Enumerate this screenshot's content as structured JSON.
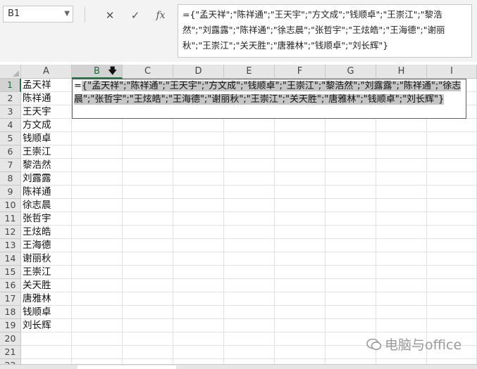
{
  "namebox": {
    "value": "B1"
  },
  "formula_bar": {
    "cancel_glyph": "✕",
    "enter_glyph": "✓",
    "fx_label": "fx",
    "formula": "={\"孟天祥\";\"陈祥通\";\"王天宇\";\"方文成\";\"钱顺卓\";\"王崇江\";\"黎浩然\";\"刘露露\";\"陈祥通\";\"徐志晨\";\"张哲宇\";\"王炫皓\";\"王海德\";\"谢丽秋\";\"王崇江\";\"关天胜\";\"唐雅林\";\"钱顺卓\";\"刘长辉\"}"
  },
  "columns": [
    "A",
    "B",
    "C",
    "D",
    "E",
    "F",
    "G",
    "H",
    "I"
  ],
  "rows": [
    "1",
    "2",
    "3",
    "4",
    "5",
    "6",
    "7",
    "8",
    "9",
    "10",
    "11",
    "12",
    "13",
    "14",
    "15",
    "16",
    "17",
    "18",
    "19",
    "20",
    "21",
    "22"
  ],
  "columnA": [
    "孟天祥",
    "陈祥通",
    "王天宇",
    "方文成",
    "钱顺卓",
    "王崇江",
    "黎浩然",
    "刘露露",
    "陈祥通",
    "徐志晨",
    "张哲宇",
    "王炫皓",
    "王海德",
    "谢丽秋",
    "王崇江",
    "关天胜",
    "唐雅林",
    "钱顺卓",
    "刘长辉"
  ],
  "edit_cell": {
    "prefix": "=",
    "selected_text": "{\"孟天祥\";\"陈祥通\";\"王天宇\";\"方文成\";\"钱顺卓\";\"王崇江\";\"黎浩然\";\"刘露露\";\"陈祥通\";\"徐志晨\";\"张哲宇\";\"王炫皓\";\"王海德\";\"谢丽秋\";\"王崇江\";\"关天胜\";\"唐雅林\";\"钱顺卓\";\"刘长辉\"}"
  },
  "watermark": {
    "text": "电脑与office"
  },
  "colors": {
    "accent": "#217346",
    "header_bg": "#e6e6e6",
    "selection": "#c6c6c6"
  }
}
